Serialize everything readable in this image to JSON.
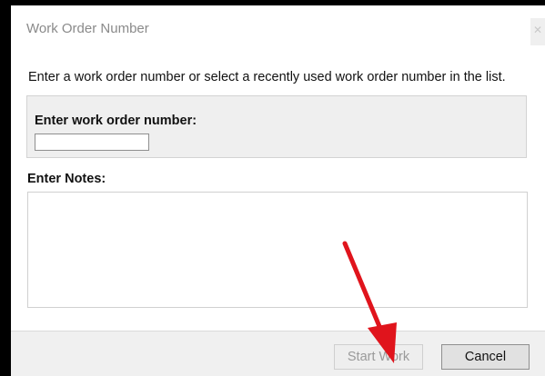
{
  "dialog": {
    "title": "Work Order Number",
    "close_icon": "close-icon",
    "instructions": "Enter a work order number or select a recently used work order number in the list."
  },
  "work_order": {
    "label": "Enter work order number:",
    "value": ""
  },
  "notes": {
    "label": "Enter Notes:",
    "value": ""
  },
  "buttons": {
    "start_work": "Start Work",
    "cancel": "Cancel"
  },
  "annotation": {
    "icon": "arrow-pointer-icon",
    "color": "#e0141c"
  },
  "colors": {
    "frame": "#000000",
    "dialog_background": "#ffffff",
    "panel_background": "#efefef",
    "footer_background": "#f0f0f0"
  }
}
